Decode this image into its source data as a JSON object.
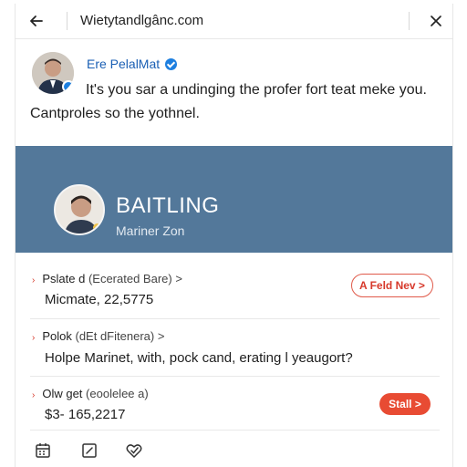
{
  "topbar": {
    "url": "Wietytandlgânc.com"
  },
  "post": {
    "author": "Ere PelalMat",
    "line1": "It's you sar a undinging the profer fort teat meke you.",
    "line2": "Cantproles so the yothnel."
  },
  "banner": {
    "title": "BAITLING",
    "subtitle": "Mariner Zon"
  },
  "rows": [
    {
      "head": "Pslate d",
      "muted": "(Ecerated Bare) >",
      "value": "Micmate, 22,5775",
      "action": "A Feld Nev >"
    },
    {
      "head": "Polok",
      "muted": "(dEt dFitenera) >",
      "value": "Holpe Marinet, with, pock cand, erating l yeaugort?"
    },
    {
      "head": "Olw get",
      "muted": "(eoolelee a)",
      "value": "$3- 165,2217",
      "action": "Stall >"
    }
  ],
  "colors": {
    "banner": "#53789a",
    "accent": "#e84b33",
    "link": "#1a5fb4"
  },
  "icons": [
    "back-arrow-icon",
    "close-icon",
    "verified-icon",
    "calendar-icon",
    "edit-icon",
    "heart-check-icon"
  ]
}
